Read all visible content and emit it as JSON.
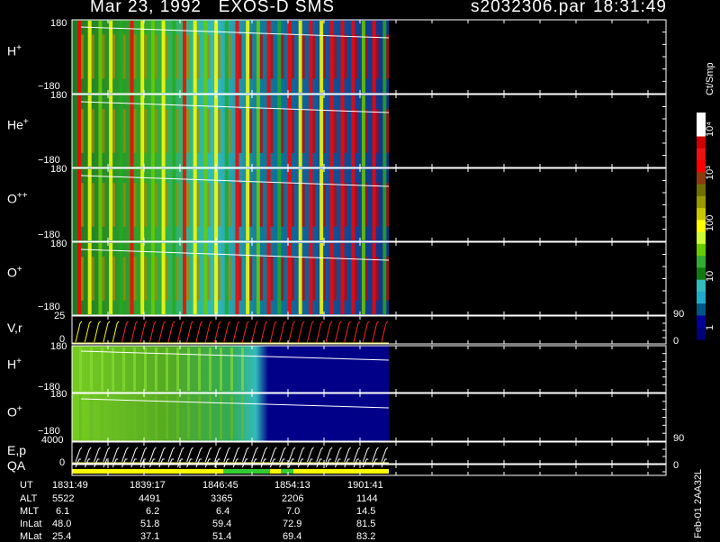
{
  "header": {
    "title": "Mar 23, 1992   EXOS-D SMS",
    "file": "s2032306.par",
    "time": "18:31:49"
  },
  "panels": [
    {
      "label": "H",
      "sup": "+",
      "ytop": "180",
      "ybot": "−180"
    },
    {
      "label": "He",
      "sup": "+",
      "ytop": "180",
      "ybot": "−180"
    },
    {
      "label": "O",
      "sup": "++",
      "ytop": "180",
      "ybot": "−180"
    },
    {
      "label": "O",
      "sup": "+",
      "ytop": "180",
      "ybot": "−180"
    },
    {
      "label": "V,r",
      "sup": "",
      "ytop": "25",
      "ybot": "0",
      "rtop": "90",
      "rbot": "0"
    },
    {
      "label": "H",
      "sup": "+",
      "ytop": "180",
      "ybot": "−180"
    },
    {
      "label": "O",
      "sup": "+",
      "ytop": "180",
      "ybot": "−180"
    },
    {
      "label": "E,p",
      "sup": "",
      "ytop": "4000",
      "ybot": "",
      "rtop": "90",
      "rbot": "0"
    },
    {
      "label": "QA",
      "sup": "",
      "ytop": "",
      "ybot": "0"
    }
  ],
  "colorbar": {
    "unit": "Ct/Smp",
    "ticks": [
      "10⁴",
      "10³",
      "100",
      "10",
      "1"
    ],
    "colors": [
      "#ffffff",
      "#ffffff",
      "#d10000",
      "#ee1111",
      "#ff0000",
      "#8b3a10",
      "#6f6f00",
      "#9a9a00",
      "#c8c800",
      "#ffff00",
      "#ccff33",
      "#66cc00",
      "#33aa33",
      "#117711",
      "#33bbbb",
      "#22aacc",
      "#005588",
      "#000099",
      "#00007a"
    ]
  },
  "ephemeris": {
    "labels": [
      "UT",
      "ALT",
      "MLT",
      "InLat",
      "MLat"
    ],
    "columns": [
      [
        "1831:49",
        "5522",
        "6.1",
        "48.0",
        "25.4"
      ],
      [
        "1839:17",
        "4491",
        "6.2",
        "51.8",
        "37.1"
      ],
      [
        "1846:45",
        "3365",
        "6.4",
        "59.4",
        "51.4"
      ],
      [
        "1854:13",
        "2206",
        "7.0",
        "72.9",
        "69.4"
      ],
      [
        "1901:41",
        "1144",
        "14.5",
        "81.5",
        "83.2"
      ]
    ]
  },
  "footer_note": "Feb-01 2AA32L",
  "chart_data": {
    "type": "heatmap",
    "title": "Mar 23, 1992   EXOS-D SMS",
    "x": [
      "1831:49",
      "1839:17",
      "1846:45",
      "1854:13",
      "1901:41"
    ],
    "y_ranges": {
      "pitch_angle": [
        -180,
        180
      ],
      "V_r": [
        0,
        25
      ],
      "E_p": [
        0,
        4000
      ]
    },
    "colorbar_scale": "log",
    "colorbar_range": [
      1,
      10000
    ],
    "series": [
      {
        "name": "H+"
      },
      {
        "name": "He+"
      },
      {
        "name": "O++"
      },
      {
        "name": "O+"
      },
      {
        "name": "V,r"
      },
      {
        "name": "H+"
      },
      {
        "name": "O+"
      },
      {
        "name": "E,p"
      },
      {
        "name": "QA"
      }
    ]
  }
}
